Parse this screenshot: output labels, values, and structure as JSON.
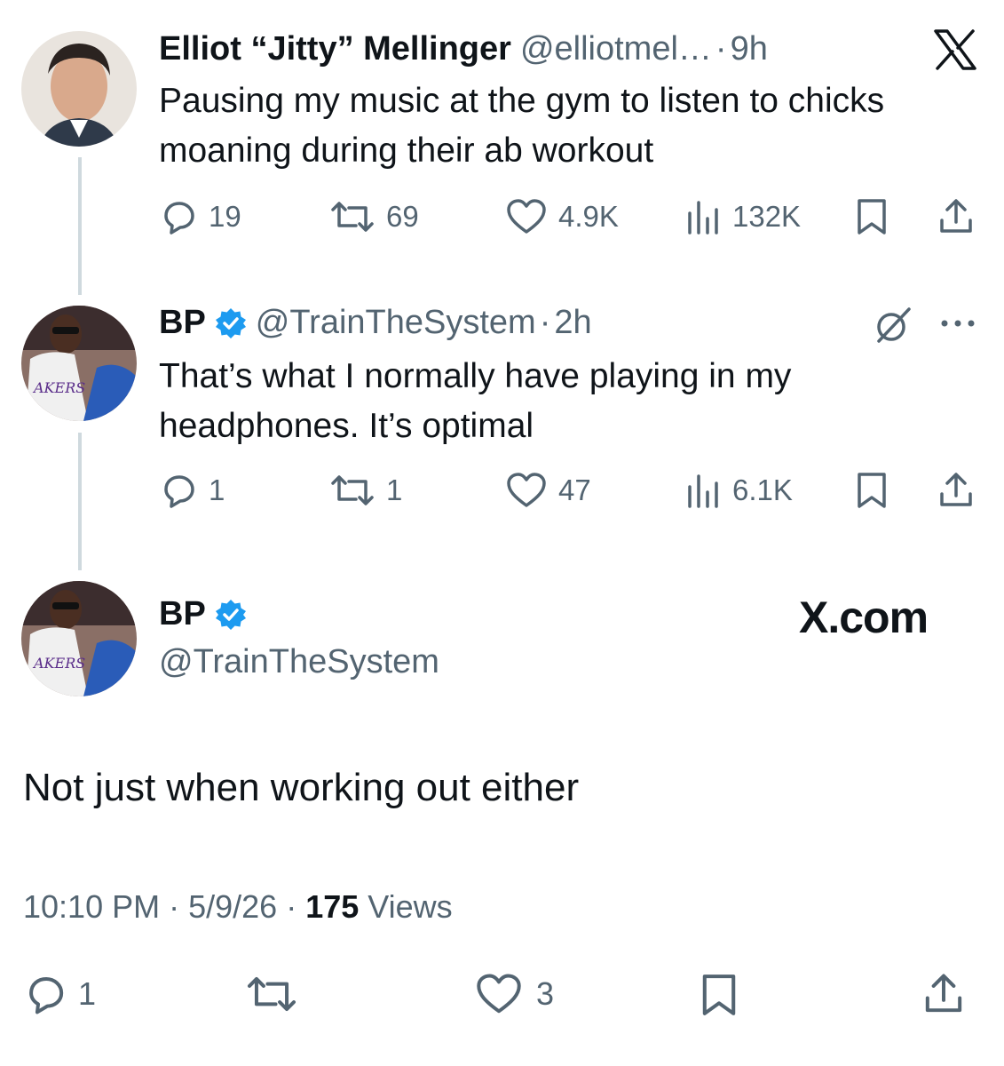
{
  "tweet1": {
    "name": "Elliot “Jitty” Mellinger",
    "handle": "@elliotmel…",
    "dot": "·",
    "time": "9h",
    "text_line1": "Pausing my music at the gym to listen to chicks",
    "text_line2": "moaning during their ab workout",
    "replies": "19",
    "reposts": "69",
    "likes": "4.9K",
    "views": "132K",
    "icon_brand": "x-logo-icon"
  },
  "tweet2": {
    "name": "BP",
    "handle": "@TrainTheSystem",
    "dot": "·",
    "time": "2h",
    "text_line1": "That’s what I normally have playing in my",
    "text_line2": "headphones. It’s optimal",
    "replies": "1",
    "reposts": "1",
    "likes": "47",
    "views": "6.1K"
  },
  "main": {
    "name": "BP",
    "handle": "@TrainTheSystem",
    "brand": "X.com",
    "text": "Not just when working out either",
    "time": "10:10 PM",
    "dot1": "·",
    "date": "5/9/26",
    "dot2": "·",
    "views_count": "175",
    "views_label": "Views",
    "replies": "1",
    "likes": "3"
  },
  "colors": {
    "text": "#0f1419",
    "secondary": "#536471",
    "verified": "#1d9bf0",
    "thread_line": "#cfd9de"
  }
}
